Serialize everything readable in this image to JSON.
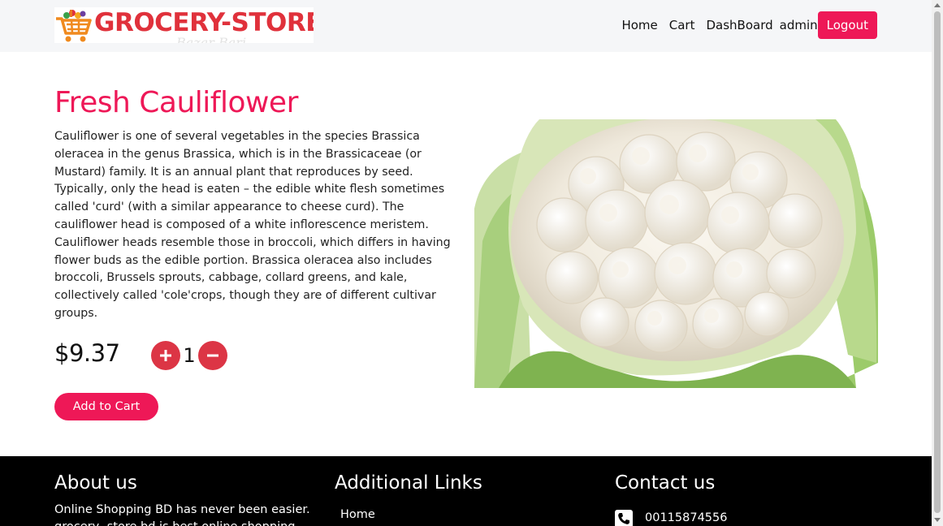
{
  "brand": {
    "name": "GROCERY-STORE",
    "color": "#e0313b",
    "tagline_watermark": "Bazar Bari"
  },
  "nav": {
    "links": [
      "Home",
      "Cart",
      "DashBoard"
    ],
    "user": "admin",
    "logout_label": "Logout"
  },
  "product": {
    "title": "Fresh Cauliflower",
    "description": "Cauliflower is one of several vegetables in the species Brassica oleracea in the genus Brassica, which is in the Brassicaceae (or Mustard) family. It is an annual plant that reproduces by seed. Typically, only the head is eaten – the edible white flesh sometimes called 'curd' (with a similar appearance to cheese curd). The cauliflower head is composed of a white inflorescence meristem. Cauliflower heads resemble those in broccoli, which differs in having flower buds as the edible portion. Brassica oleracea also includes broccoli, Brussels sprouts, cabbage, collard greens, and kale, collectively called 'cole'crops, though they are of different cultivar groups.",
    "price": "$9.37",
    "quantity": "1",
    "add_to_cart_label": "Add to Cart",
    "image_icon": "cauliflower-photo"
  },
  "footer": {
    "about_heading": "About us",
    "about_text": "Online Shopping BD has never been easier. grocery- store bd is best online shopping",
    "links_heading": "Additional Links",
    "links": [
      "Home"
    ],
    "contact_heading": "Contact us",
    "phone": "00115874556"
  },
  "colors": {
    "accent": "#ee1857",
    "qty_button": "#dc3545",
    "footer_bg": "#000000",
    "navbar_bg": "#f5f6f8"
  }
}
